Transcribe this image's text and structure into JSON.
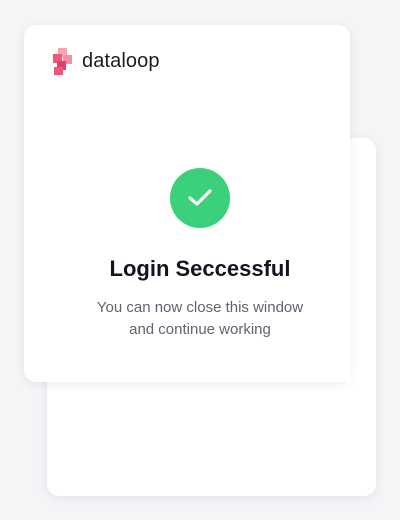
{
  "brand": {
    "name": "dataloop",
    "logo_icon": "dataloop-logo-icon",
    "logo_color": "#f0567a"
  },
  "status": {
    "icon": "checkmark-icon",
    "color": "#3bd07b",
    "title": "Login Seccessful",
    "message_line1": "You can now close this window",
    "message_line2": "and continue working"
  }
}
